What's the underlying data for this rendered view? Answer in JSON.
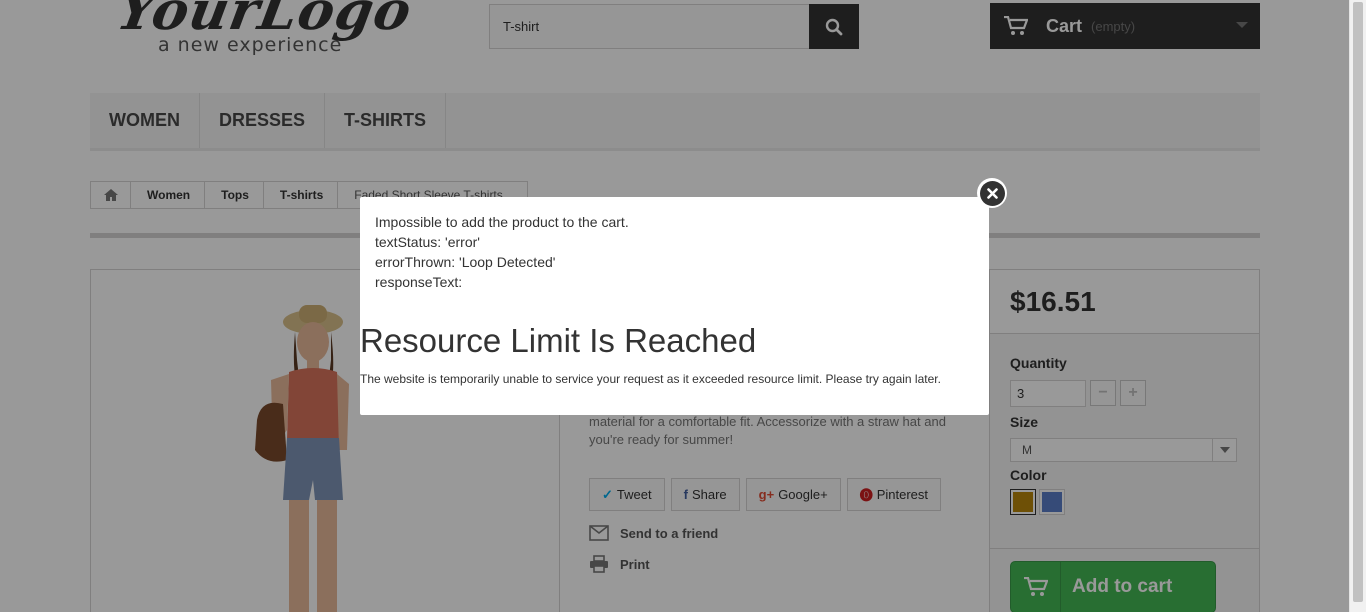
{
  "header": {
    "logo_text": "YourLogo",
    "logo_tagline": "a new experience",
    "search": {
      "value": "T-shirt"
    },
    "cart": {
      "label": "Cart",
      "status": "(empty)"
    }
  },
  "menu": {
    "items": [
      "WOMEN",
      "DRESSES",
      "T-SHIRTS"
    ]
  },
  "breadcrumb": {
    "items": [
      "Women",
      "Tops",
      "T-shirts",
      "Faded Short Sleeve T-shirts"
    ]
  },
  "product": {
    "description_tail": "material for a comfortable fit. Accessorize with a straw hat and you're ready for summer!",
    "socials": [
      "Tweet",
      "Share",
      "Google+",
      "Pinterest"
    ],
    "send_to_friend": "Send to a friend",
    "print": "Print",
    "price": "$16.51",
    "quantity_label": "Quantity",
    "quantity_value": "3",
    "size_label": "Size",
    "size_value": "M",
    "color_label": "Color",
    "colors": [
      "#b8860b",
      "#5b7ec9"
    ],
    "add_to_cart": "Add to cart"
  },
  "modal": {
    "line1": "Impossible to add the product to the cart.",
    "line2": "textStatus: 'error'",
    "line3": "errorThrown: 'Loop Detected'",
    "line4": "responseText:",
    "heading": "Resource Limit Is Reached",
    "message": "The website is temporarily unable to service your request as it exceeded resource limit. Please try again later."
  },
  "colors": {
    "accent_green": "#43b754",
    "dark": "#333333"
  }
}
